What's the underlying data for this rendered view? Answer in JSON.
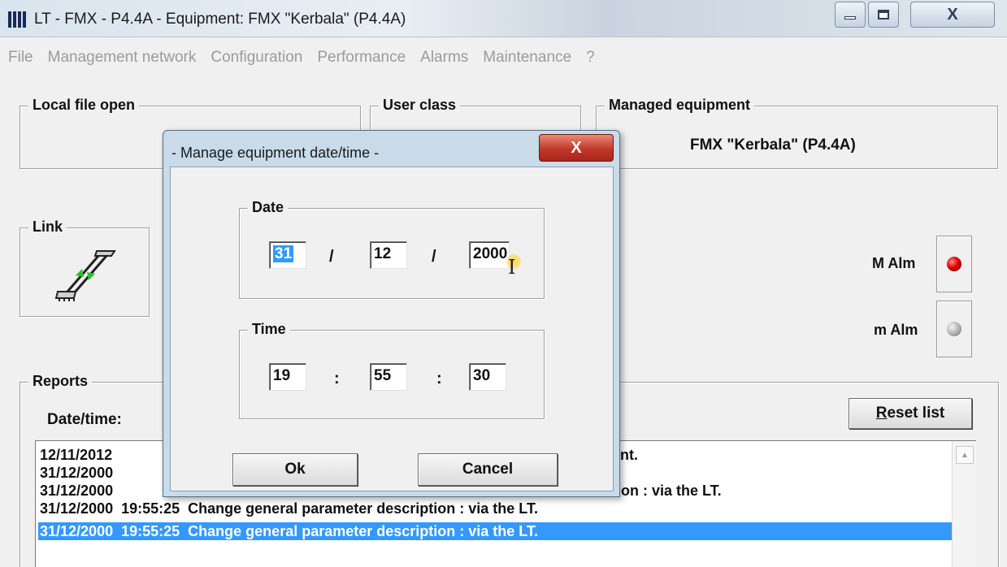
{
  "window": {
    "title": "LT - FMX - P4.4A - Equipment: FMX \"Kerbala\" (P4.4A)",
    "close_glyph": "X"
  },
  "menu": [
    "File",
    "Management network",
    "Configuration",
    "Performance",
    "Alarms",
    "Maintenance",
    "?"
  ],
  "groups": {
    "local_file": "Local file open",
    "user_class": "User class",
    "managed_equipment": "Managed equipment",
    "managed_equipment_value": "FMX \"Kerbala\" (P4.4A)",
    "link": "Link",
    "reports": "Reports"
  },
  "alarms": {
    "major_label": "M Alm",
    "major_color": "#e00000",
    "minor_label": "m Alm",
    "minor_color": "#b5b5b5"
  },
  "reports": {
    "datetime_label": "Date/time:",
    "reset_button_prefix": "",
    "reset_button_accel": "R",
    "reset_button_rest": "eset list",
    "rows": [
      {
        "datetime": "12/11/2012",
        "text": "ent."
      },
      {
        "datetime": "31/12/2000",
        "text": ""
      },
      {
        "datetime": "31/12/2000",
        "text": "tion : via the LT."
      },
      {
        "datetime": "31/12/2000  19:55:25",
        "text": "Change general parameter description : via the LT."
      },
      {
        "datetime": "31/12/2000  19:55:25",
        "text": "Change general parameter description : via the LT."
      }
    ]
  },
  "dialog": {
    "title": "- Manage equipment  date/time -",
    "close_glyph": "X",
    "date_legend": "Date",
    "day": "31",
    "month": "12",
    "year": "2000",
    "date_sep": "/",
    "time_legend": "Time",
    "hour": "19",
    "minute": "55",
    "second": "30",
    "time_sep": ":",
    "ok_label": "Ok",
    "cancel_label": "Cancel"
  }
}
